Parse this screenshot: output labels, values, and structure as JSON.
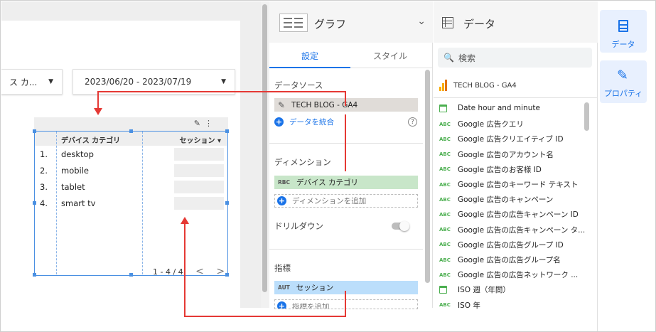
{
  "canvas": {
    "dropdown_category": "ス カ...",
    "dropdown_date": "2023/06/20 - 2023/07/19",
    "table": {
      "headers": [
        "デバイス カテゴリ",
        "セッション ▾"
      ],
      "rows": [
        {
          "num": "1.",
          "name": "desktop"
        },
        {
          "num": "2.",
          "name": "mobile"
        },
        {
          "num": "3.",
          "name": "tablet"
        },
        {
          "num": "4.",
          "name": "smart tv"
        }
      ],
      "pager": "1 - 4 / 4",
      "prev": "<",
      "next": ">"
    }
  },
  "graph_panel": {
    "title": "グラフ",
    "tabs": [
      "設定",
      "スタイル"
    ],
    "datasource_label": "データソース",
    "datasource_name": "TECH BLOG - GA4",
    "blend_label": "データを統合",
    "help": "?",
    "dimension_label": "ディメンション",
    "dimension_chip": {
      "tag": "RBC",
      "name": "デバイス カテゴリ"
    },
    "add_dimension": "ディメンションを追加",
    "drilldown_label": "ドリルダウン",
    "metric_label": "指標",
    "metric_chip": {
      "tag": "AUT",
      "name": "セッション"
    },
    "add_metric": "指標を追加"
  },
  "data_panel": {
    "title": "データ",
    "search_placeholder": "検索",
    "source_name": "TECH BLOG - GA4",
    "fields": [
      {
        "type": "cal",
        "name": "Date hour and minute"
      },
      {
        "type": "ABC",
        "name": "Google 広告クエリ"
      },
      {
        "type": "ABC",
        "name": "Google 広告クリエイティブ ID"
      },
      {
        "type": "ABC",
        "name": "Google 広告のアカウント名"
      },
      {
        "type": "ABC",
        "name": "Google 広告のお客様 ID"
      },
      {
        "type": "ABC",
        "name": "Google 広告のキーワード テキスト"
      },
      {
        "type": "ABC",
        "name": "Google 広告のキャンペーン"
      },
      {
        "type": "ABC",
        "name": "Google 広告の広告キャンペーン ID"
      },
      {
        "type": "ABC",
        "name": "Google 広告の広告キャンペーン タ..."
      },
      {
        "type": "ABC",
        "name": "Google 広告の広告グループ ID"
      },
      {
        "type": "ABC",
        "name": "Google 広告の広告グループ名"
      },
      {
        "type": "ABC",
        "name": "Google 広告の広告ネットワーク ..."
      },
      {
        "type": "cal",
        "name": "ISO 週（年間）"
      },
      {
        "type": "ABC",
        "name": "ISO 年"
      }
    ]
  },
  "side_strip": {
    "data_label": "データ",
    "property_label": "プロパティ"
  },
  "colors": {
    "accent": "#1a73e8",
    "dimension_chip": "#c8e6c9",
    "metric_chip": "#bbdefb",
    "datasource_chip": "#e0dcd8",
    "arrow": "#e53935",
    "selection": "#4a90e2"
  }
}
